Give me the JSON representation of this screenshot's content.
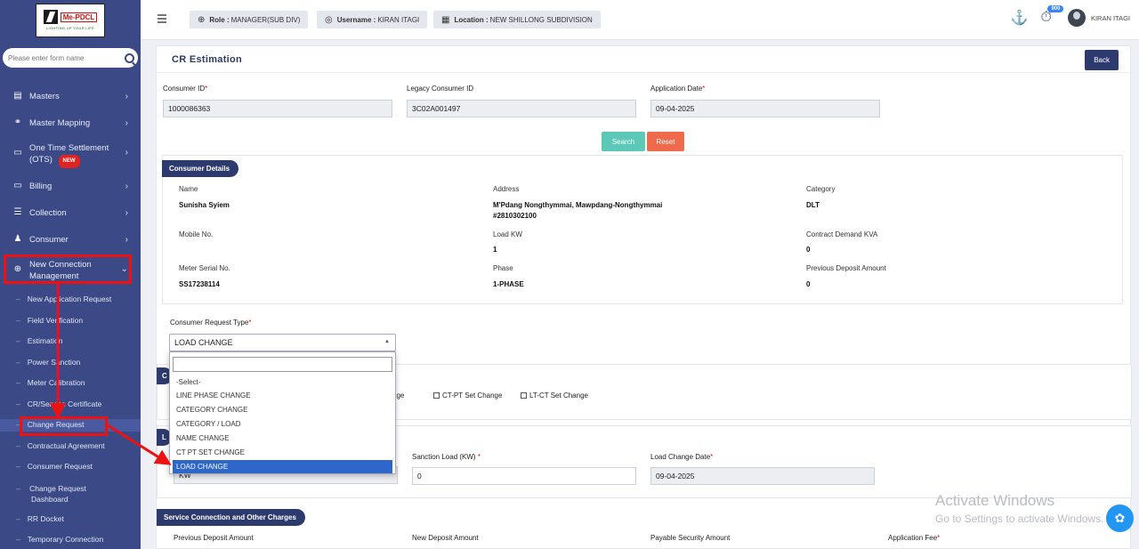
{
  "app": {
    "logo_text": "Me-PDCL",
    "logo_tagline": "LIGHTING UP YOUR LIFE"
  },
  "sidebar": {
    "search_placeholder": "Please enter form name",
    "menu": [
      {
        "label": "Masters",
        "icon": "list-icon"
      },
      {
        "label": "Master Mapping",
        "icon": "sitemap-icon"
      },
      {
        "label": "One Time Settlement",
        "label2": "(OTS)",
        "badge": "NEW",
        "icon": "monitor-icon"
      },
      {
        "label": "Billing",
        "icon": "monitor-icon"
      },
      {
        "label": "Collection",
        "icon": "list-icon"
      },
      {
        "label": "Consumer",
        "icon": "user-icon"
      },
      {
        "label": "New Connection",
        "label2": "Management",
        "icon": "plus-circle-icon"
      }
    ],
    "submenu": [
      "New Application Request",
      "Field Verification",
      "Estimation",
      "Power Sanction",
      "Meter Calibration",
      "CR/Service Certificate",
      "Change Request",
      "Contractual Agreement",
      "Consumer Request",
      "Change Request",
      "Dashboard",
      "RR Docket",
      "Temporary Connection"
    ]
  },
  "topbar": {
    "role_label": "Role :",
    "role_value": "MANAGER(SUB DIV)",
    "username_label": "Username :",
    "username_value": "KIRAN ITAGI",
    "location_label": "Location :",
    "location_value": "NEW SHILLONG SUBDIVISION",
    "notification_count": "900",
    "user_name": "KIRAN ITAGI"
  },
  "page": {
    "title": "CR Estimation",
    "back_label": "Back",
    "consumer_id_label": "Consumer ID",
    "consumer_id_value": "1000086363",
    "legacy_id_label": "Legacy Consumer ID",
    "legacy_id_value": "3C02A001497",
    "app_date_label": "Application Date",
    "app_date_value": "09-04-2025",
    "search_label": "Search",
    "reset_label": "Reset"
  },
  "consumer_details": {
    "tag": "Consumer Details",
    "name_label": "Name",
    "name_value": "Sunisha Syiem",
    "address_label": "Address",
    "address_value_1": "M'Pdang Nongthymmai, Mawpdang-Nongthymmai",
    "address_value_2": "#2810302100",
    "category_label": "Category",
    "category_value": "DLT",
    "mobile_label": "Mobile No.",
    "load_kw_label": "Load KW",
    "load_kw_value": "1",
    "contract_label": "Contract Demand KVA",
    "contract_value": "0",
    "meter_label": "Meter Serial No.",
    "meter_value": "SS17238114",
    "phase_label": "Phase",
    "phase_value": "1-PHASE",
    "prev_deposit_label": "Previous Deposit Amount",
    "prev_deposit_value": "0"
  },
  "request": {
    "type_label": "Consumer Request Type",
    "selected": "LOAD CHANGE",
    "options": [
      "-Select-",
      "LINE PHASE CHANGE",
      "CATEGORY CHANGE",
      "CATEGORY / LOAD",
      "NAME CHANGE",
      "CT PT SET CHANGE",
      "LOAD CHANGE"
    ],
    "section_initial": "C",
    "cb_partial": "nge",
    "cb1": "CT-PT Set Change",
    "cb2": "LT-CT Set Change"
  },
  "load_section": {
    "tag_initial": "L",
    "kw_text": "KW",
    "sanction_label": "Sanction Load (KW)",
    "sanction_value": "0",
    "date_label": "Load Change Date",
    "date_value": "09-04-2025"
  },
  "charges": {
    "tag": "Service Connection and Other Charges",
    "prev_deposit": "Previous Deposit Amount",
    "new_deposit": "New Deposit Amount",
    "payable": "Payable Security Amount",
    "app_fee": "Application Fee"
  },
  "watermark": {
    "line1": "Activate Windows",
    "line2": "Go to Settings to activate Windows."
  },
  "colors": {
    "sidebar": "#3b4a86",
    "primary": "#2d3a6e",
    "search_btn": "#5bc8b8",
    "reset_btn": "#ee6a4a",
    "annotation": "#e11111"
  }
}
